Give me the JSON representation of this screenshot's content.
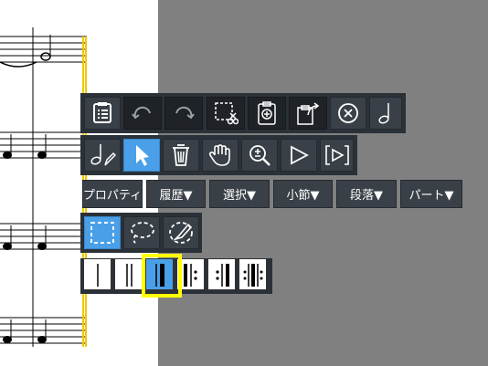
{
  "toolbar_row1": {
    "icons": [
      "score-list-icon",
      "undo-icon",
      "redo-icon",
      "cut-selection-icon",
      "paste-clipboard-icon",
      "export-icon",
      "close-circle-icon",
      "note-half-icon"
    ]
  },
  "toolbar_row2": {
    "icons": [
      "note-pencil-icon",
      "pointer-arrow-icon",
      "delete-trash-icon",
      "hand-pan-icon",
      "zoom-icon",
      "play-icon",
      "play-bracket-icon"
    ]
  },
  "menu": {
    "properties": "プロパティ",
    "history": "履歴▼",
    "selection": "選択▼",
    "measure": "小節▼",
    "paragraph": "段落▼",
    "part": "パート▼"
  },
  "selection_tools": {
    "icons": [
      "rectangle-select-icon",
      "lasso-select-icon",
      "brush-select-icon"
    ]
  },
  "barlines": {
    "icons": [
      "single-barline-icon",
      "double-barline-icon",
      "final-barline-icon",
      "repeat-start-icon",
      "repeat-end-icon",
      "repeat-both-icon"
    ],
    "selected_index": 2
  }
}
